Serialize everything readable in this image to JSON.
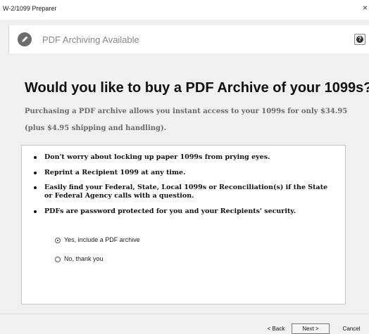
{
  "window": {
    "title": "W-2/1099 Preparer",
    "close_glyph": "×"
  },
  "header": {
    "icon": "pen-edit-icon",
    "title": "PDF Archiving Available",
    "help_glyph": "?"
  },
  "main": {
    "heading": "Would you like to buy a PDF Archive of your 1099s?",
    "intro": "Purchasing a PDF archive allows you instant access to your 1099s for only $34.95 (plus $4.95 shipping and handling).",
    "bullets": [
      "Don't worry about locking up paper 1099s from prying eyes.",
      "Reprint a Recipient 1099 at any time.",
      "Easily find your Federal, State, Local 1099s or Reconciliation(s) if the State or Federal Agency calls with a question.",
      "PDFs are password protected for you and your Recipients' security."
    ],
    "options": [
      {
        "label": "Yes, include a PDF archive",
        "selected": true
      },
      {
        "label": "No, thank you",
        "selected": false
      }
    ]
  },
  "footer": {
    "back_label": "< Back",
    "next_label": "Next >",
    "cancel_label": "Cancel"
  }
}
